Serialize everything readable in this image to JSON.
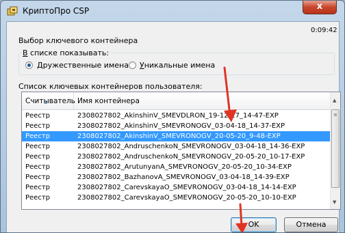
{
  "window": {
    "title": "КриптоПро CSP",
    "close_label": "x",
    "timer": "0:09:42"
  },
  "dialog": {
    "heading": "Выбор ключевого контейнера",
    "show_group_label": "В списке показывать:",
    "show_group_accesskey": "В",
    "show_group_rest": " списке показывать:",
    "radios": [
      {
        "accesskey": "Д",
        "rest": "ружественные имена",
        "checked": true
      },
      {
        "accesskey": "У",
        "rest": "никальные имена",
        "checked": false
      }
    ],
    "list_label": "Список ключевых контейнеров пользователя:"
  },
  "table": {
    "columns": [
      "Считыватель",
      "Имя контейнера"
    ],
    "rows": [
      {
        "reader": "Реестр",
        "name": "2308027802_AkinshinV_SMEVDLRON_19-12-17_14-47-EXP"
      },
      {
        "reader": "Реестр",
        "name": "2308027802_AkinshinV_SMEVRONOGV_03-04-18_14-37-EXP"
      },
      {
        "reader": "Реестр",
        "name": "2308027802_AkinshinV_SMEVRONOGV_20-05-20_9-48-EXP",
        "selected": true
      },
      {
        "reader": "Реестр",
        "name": "2308027802_AndruschenkoN_SMEVRONOGV_03-04-18_14-36-EXP"
      },
      {
        "reader": "Реестр",
        "name": "2308027802_AndruschenkoN_SMEVRONOGV_20-05-20_10-17-EXP"
      },
      {
        "reader": "Реестр",
        "name": "2308027802_ArutunyanA_SMEVRONOGV_20-05-20_10-34-EXP"
      },
      {
        "reader": "Реестр",
        "name": "2308027802_BazhanovA_SMEVRONOGV_03-04-18_14-39-EXP"
      },
      {
        "reader": "Реестр",
        "name": "2308027802_CarevskayaO_SMEVRONOGV_03-04-18_14-14-EXP"
      },
      {
        "reader": "Реестр",
        "name": "2308027802_CarevskayaO_SMEVRONOGV_20-05-20_10-10-EXP"
      }
    ]
  },
  "buttons": {
    "ok": "OK",
    "cancel": "Отмена"
  },
  "colors": {
    "selection": "#3399ff",
    "annotation_arrow": "#e03324"
  }
}
